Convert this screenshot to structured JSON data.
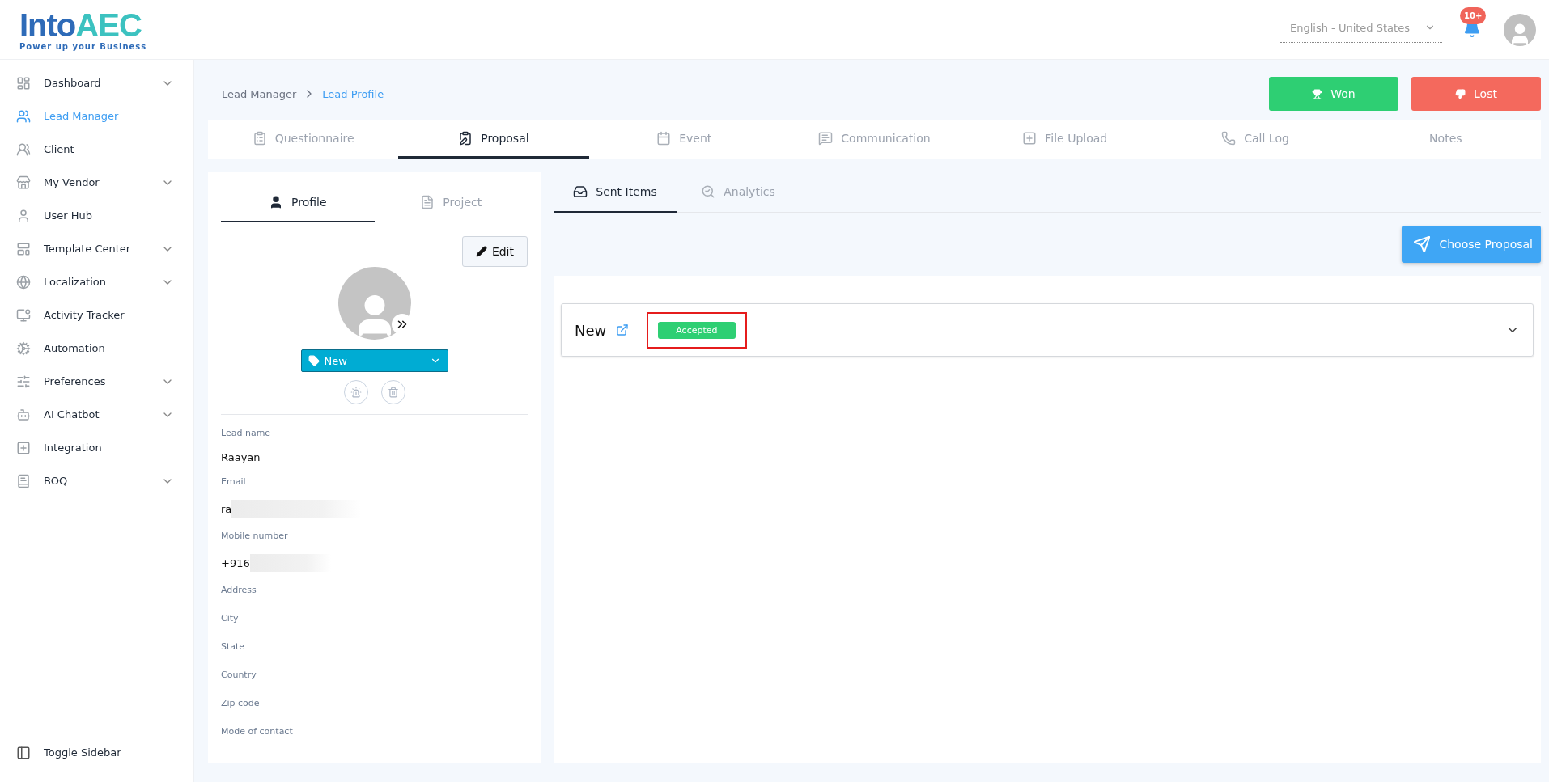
{
  "header": {
    "logo": {
      "word": "Into",
      "accent": "AEC",
      "tagline": "Power up your Business"
    },
    "language": "English - United States",
    "notification_badge": "10+"
  },
  "sidebar": {
    "items": [
      {
        "label": "Dashboard",
        "selected": false,
        "has_submenu": true
      },
      {
        "label": "Lead Manager",
        "selected": true,
        "has_submenu": false
      },
      {
        "label": "Client",
        "selected": false,
        "has_submenu": false
      },
      {
        "label": "My Vendor",
        "selected": false,
        "has_submenu": true
      },
      {
        "label": "User Hub",
        "selected": false,
        "has_submenu": false
      },
      {
        "label": "Template Center",
        "selected": false,
        "has_submenu": true
      },
      {
        "label": "Localization",
        "selected": false,
        "has_submenu": true
      },
      {
        "label": "Activity Tracker",
        "selected": false,
        "has_submenu": false
      },
      {
        "label": "Automation",
        "selected": false,
        "has_submenu": false
      },
      {
        "label": "Preferences",
        "selected": false,
        "has_submenu": true
      },
      {
        "label": "AI Chatbot",
        "selected": false,
        "has_submenu": true
      },
      {
        "label": "Integration",
        "selected": false,
        "has_submenu": false
      },
      {
        "label": "BOQ",
        "selected": false,
        "has_submenu": true
      }
    ],
    "toggle": "Toggle Sidebar"
  },
  "breadcrumb": [
    {
      "label": "Lead Manager",
      "selected": false
    },
    {
      "label": "Lead Profile",
      "selected": true
    }
  ],
  "actions": [
    {
      "label": "Won",
      "kind": "won"
    },
    {
      "label": "Lost",
      "kind": "lost"
    }
  ],
  "tabs": [
    {
      "label": "Questionnaire",
      "selected": false
    },
    {
      "label": "Proposal",
      "selected": true
    },
    {
      "label": "Event",
      "selected": false
    },
    {
      "label": "Communication",
      "selected": false
    },
    {
      "label": "File Upload",
      "selected": false
    },
    {
      "label": "Call Log",
      "selected": false
    },
    {
      "label": "Notes",
      "selected": false
    }
  ],
  "profile_card": {
    "tabs": [
      {
        "label": "Profile",
        "selected": true
      },
      {
        "label": "Project",
        "selected": false
      }
    ],
    "edit": "Edit",
    "stage": "New",
    "fields": [
      {
        "label": "Lead name",
        "value": "Raayan",
        "redacted": false
      },
      {
        "label": "Email",
        "value": "ra",
        "redacted": true
      },
      {
        "label": "Mobile number",
        "value": "+916",
        "redacted": true
      },
      {
        "label": "Address"
      },
      {
        "label": "City"
      },
      {
        "label": "State"
      },
      {
        "label": "Country"
      },
      {
        "label": "Zip code"
      },
      {
        "label": "Mode of contact"
      }
    ]
  },
  "proposals": {
    "tabs": [
      {
        "label": "Sent Items",
        "selected": true
      },
      {
        "label": "Analytics",
        "selected": false
      }
    ],
    "choose": "Choose Proposal",
    "items": [
      {
        "title": "New",
        "status": "Accepted",
        "highlighted": true,
        "expanded": false
      }
    ]
  }
}
